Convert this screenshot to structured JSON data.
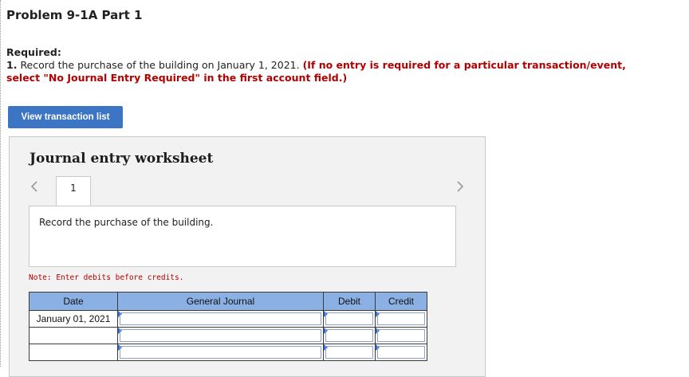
{
  "header": {
    "title": "Problem 9-1A Part 1"
  },
  "instructions": {
    "required_label": "Required:",
    "number": "1.",
    "text": "Record the purchase of the building on January 1, 2021.",
    "note_red": "(If no entry is required for a particular transaction/event, select \"No Journal Entry Required\" in the first account field.)"
  },
  "buttons": {
    "view_transaction_list": "View transaction list"
  },
  "worksheet": {
    "title": "Journal entry worksheet",
    "tabs": [
      "1"
    ],
    "description": "Record the purchase of the building.",
    "note": "Note: Enter debits before credits.",
    "columns": [
      "Date",
      "General Journal",
      "Debit",
      "Credit"
    ],
    "rows": [
      {
        "date": "January 01, 2021",
        "account": "",
        "debit": "",
        "credit": ""
      },
      {
        "date": "",
        "account": "",
        "debit": "",
        "credit": ""
      },
      {
        "date": "",
        "account": "",
        "debit": "",
        "credit": ""
      }
    ]
  },
  "icons": {
    "prev": "chevron-left-icon",
    "next": "chevron-right-icon"
  },
  "colors": {
    "button": "#3b75c4",
    "table_header": "#8ab0e4",
    "note_red": "#b30000"
  }
}
